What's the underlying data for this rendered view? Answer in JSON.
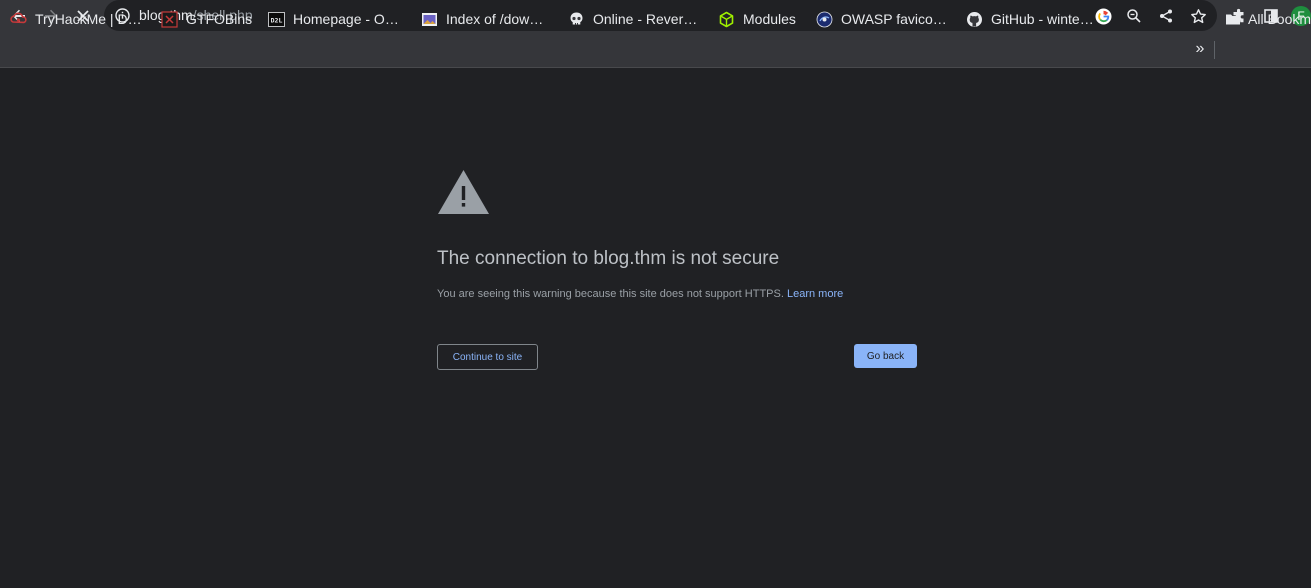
{
  "browser": {
    "url_host": "blog.thm",
    "url_path": "/shell.php",
    "profile_initial": "F",
    "accent_color": "#8ab4f8",
    "profile_color": "#1e8e3e"
  },
  "toolbar_icons": [
    "back-arrow-icon",
    "forward-arrow-icon",
    "stop-loading-icon",
    "info-icon",
    "google-icon",
    "zoom-icon",
    "share-icon",
    "star-icon",
    "extensions-icon",
    "side-panel-icon"
  ],
  "bookmarks": {
    "items": [
      {
        "label": "TryHackMe | D…",
        "icon": "tryhackme-icon"
      },
      {
        "label": "GTFOBins",
        "icon": "gtfobins-icon"
      },
      {
        "label": "Homepage - O…",
        "icon": "d2l-icon"
      },
      {
        "label": "Index of /dow…",
        "icon": "folder-image-icon"
      },
      {
        "label": "Online - Rever…",
        "icon": "skull-icon"
      },
      {
        "label": "Modules",
        "icon": "cube-icon"
      },
      {
        "label": "OWASP favico…",
        "icon": "owasp-icon"
      },
      {
        "label": "GitHub - winte…",
        "icon": "github-icon"
      }
    ],
    "more": "»",
    "all_bookmarks_label": "All Bookm"
  },
  "interstitial": {
    "heading": "The connection to blog.thm is not secure",
    "explanation": "You are seeing this warning because this site does not support HTTPS.",
    "learn_more": "Learn more",
    "continue_label": "Continue to site",
    "go_back_label": "Go back"
  }
}
